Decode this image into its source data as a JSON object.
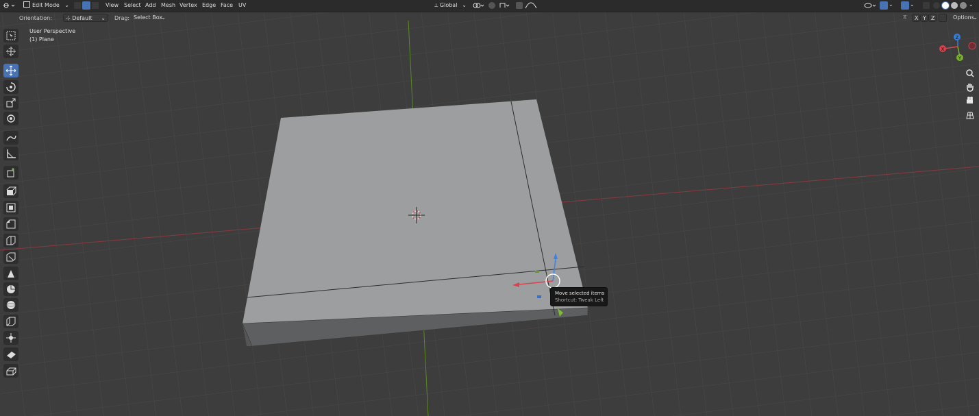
{
  "header": {
    "mode": "Edit Mode",
    "menus": [
      "View",
      "Select",
      "Add",
      "Mesh",
      "Vertex",
      "Edge",
      "Face",
      "UV"
    ],
    "transform_orientation": "Global",
    "options_label": "Options",
    "axis_toggles": [
      "X",
      "Y",
      "Z"
    ]
  },
  "tool_settings": {
    "orientation_label": "Orientation:",
    "orientation_value": "Default",
    "drag_label": "Drag:",
    "drag_value": "Select Box"
  },
  "viewport": {
    "view_name": "User Perspective",
    "object_name": "(1) Plane"
  },
  "gizmo": {
    "x_label": "X",
    "y_label": "Y",
    "z_label": "Z"
  },
  "tooltip": {
    "title": "Move selected items",
    "shortcut": "Shortcut: Tweak Left"
  },
  "toolbar": {
    "tools": [
      "select-box",
      "cursor",
      "move",
      "rotate",
      "scale",
      "transform",
      "annotate",
      "measure",
      "add-cube",
      "extrude-region",
      "inset-faces",
      "bevel",
      "loop-cut",
      "knife",
      "poly-build",
      "spin",
      "smooth",
      "edge-slide",
      "shrink-fatten",
      "shear",
      "rip-region"
    ],
    "active_tool": "move"
  },
  "colors": {
    "background": "#3d3d3d",
    "header": "#2b2b2b",
    "accent": "#4772b3",
    "x_axis": "#c83c4b",
    "y_axis": "#6a9a23",
    "z_axis": "#2f7fe0",
    "mesh_top": "#9d9e9f",
    "mesh_side": "#6d6e6f"
  }
}
